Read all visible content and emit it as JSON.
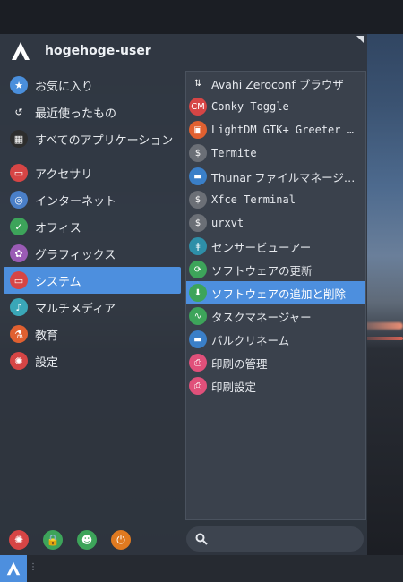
{
  "header": {
    "username": "hogehoge-user"
  },
  "categories": [
    {
      "label": "お気に入り",
      "icon": "folder-star-icon",
      "color": "#4a8fdc"
    },
    {
      "label": "最近使ったもの",
      "icon": "history-icon",
      "color": "transparent"
    },
    {
      "label": "すべてのアプリケーション",
      "icon": "all-apps-icon",
      "color": "#2d2d2d"
    },
    {
      "label": "アクセサリ",
      "icon": "accessories-icon",
      "color": "#d64545"
    },
    {
      "label": "インターネット",
      "icon": "internet-icon",
      "color": "#4a7fc8"
    },
    {
      "label": "オフィス",
      "icon": "office-icon",
      "color": "#3da45a"
    },
    {
      "label": "グラフィックス",
      "icon": "graphics-icon",
      "color": "#9a5bb5"
    },
    {
      "label": "システム",
      "icon": "system-icon",
      "color": "#d64545"
    },
    {
      "label": "マルチメディア",
      "icon": "multimedia-icon",
      "color": "#3aa7b8"
    },
    {
      "label": "教育",
      "icon": "education-icon",
      "color": "#e06030"
    },
    {
      "label": "設定",
      "icon": "settings-icon",
      "color": "#d64545"
    }
  ],
  "selected_category": "システム",
  "apps": [
    {
      "label": "Avahi Zeroconf ブラウザ",
      "icon": "avahi-icon",
      "mono": false
    },
    {
      "label": "Conky Toggle",
      "icon": "conky-icon",
      "mono": true
    },
    {
      "label": "LightDM GTK+ Greeter …",
      "icon": "lightdm-icon",
      "mono": true
    },
    {
      "label": "Termite",
      "icon": "terminal-icon",
      "mono": true
    },
    {
      "label": "Thunar ファイルマネージ…",
      "icon": "thunar-icon",
      "mono": false
    },
    {
      "label": "Xfce Terminal",
      "icon": "terminal-icon",
      "mono": true
    },
    {
      "label": "urxvt",
      "icon": "terminal-icon",
      "mono": true
    },
    {
      "label": "センサービューアー",
      "icon": "sensor-icon",
      "mono": false
    },
    {
      "label": "ソフトウェアの更新",
      "icon": "update-icon",
      "mono": false
    },
    {
      "label": "ソフトウェアの追加と削除",
      "icon": "software-install-icon",
      "mono": false
    },
    {
      "label": "タスクマネージャー",
      "icon": "task-manager-icon",
      "mono": false
    },
    {
      "label": "バルクリネーム",
      "icon": "bulk-rename-icon",
      "mono": false
    },
    {
      "label": "印刷の管理",
      "icon": "printer-icon",
      "mono": false
    },
    {
      "label": "印刷設定",
      "icon": "printer-icon",
      "mono": false
    }
  ],
  "selected_app": "ソフトウェアの追加と削除",
  "bottom_actions": [
    {
      "icon": "settings-icon",
      "color": "#d64545"
    },
    {
      "icon": "lock-icon",
      "color": "#3da45a"
    },
    {
      "icon": "switch-user-icon",
      "color": "#3da45a"
    },
    {
      "icon": "logout-icon",
      "color": "#e07a20"
    }
  ],
  "search": {
    "placeholder": ""
  }
}
